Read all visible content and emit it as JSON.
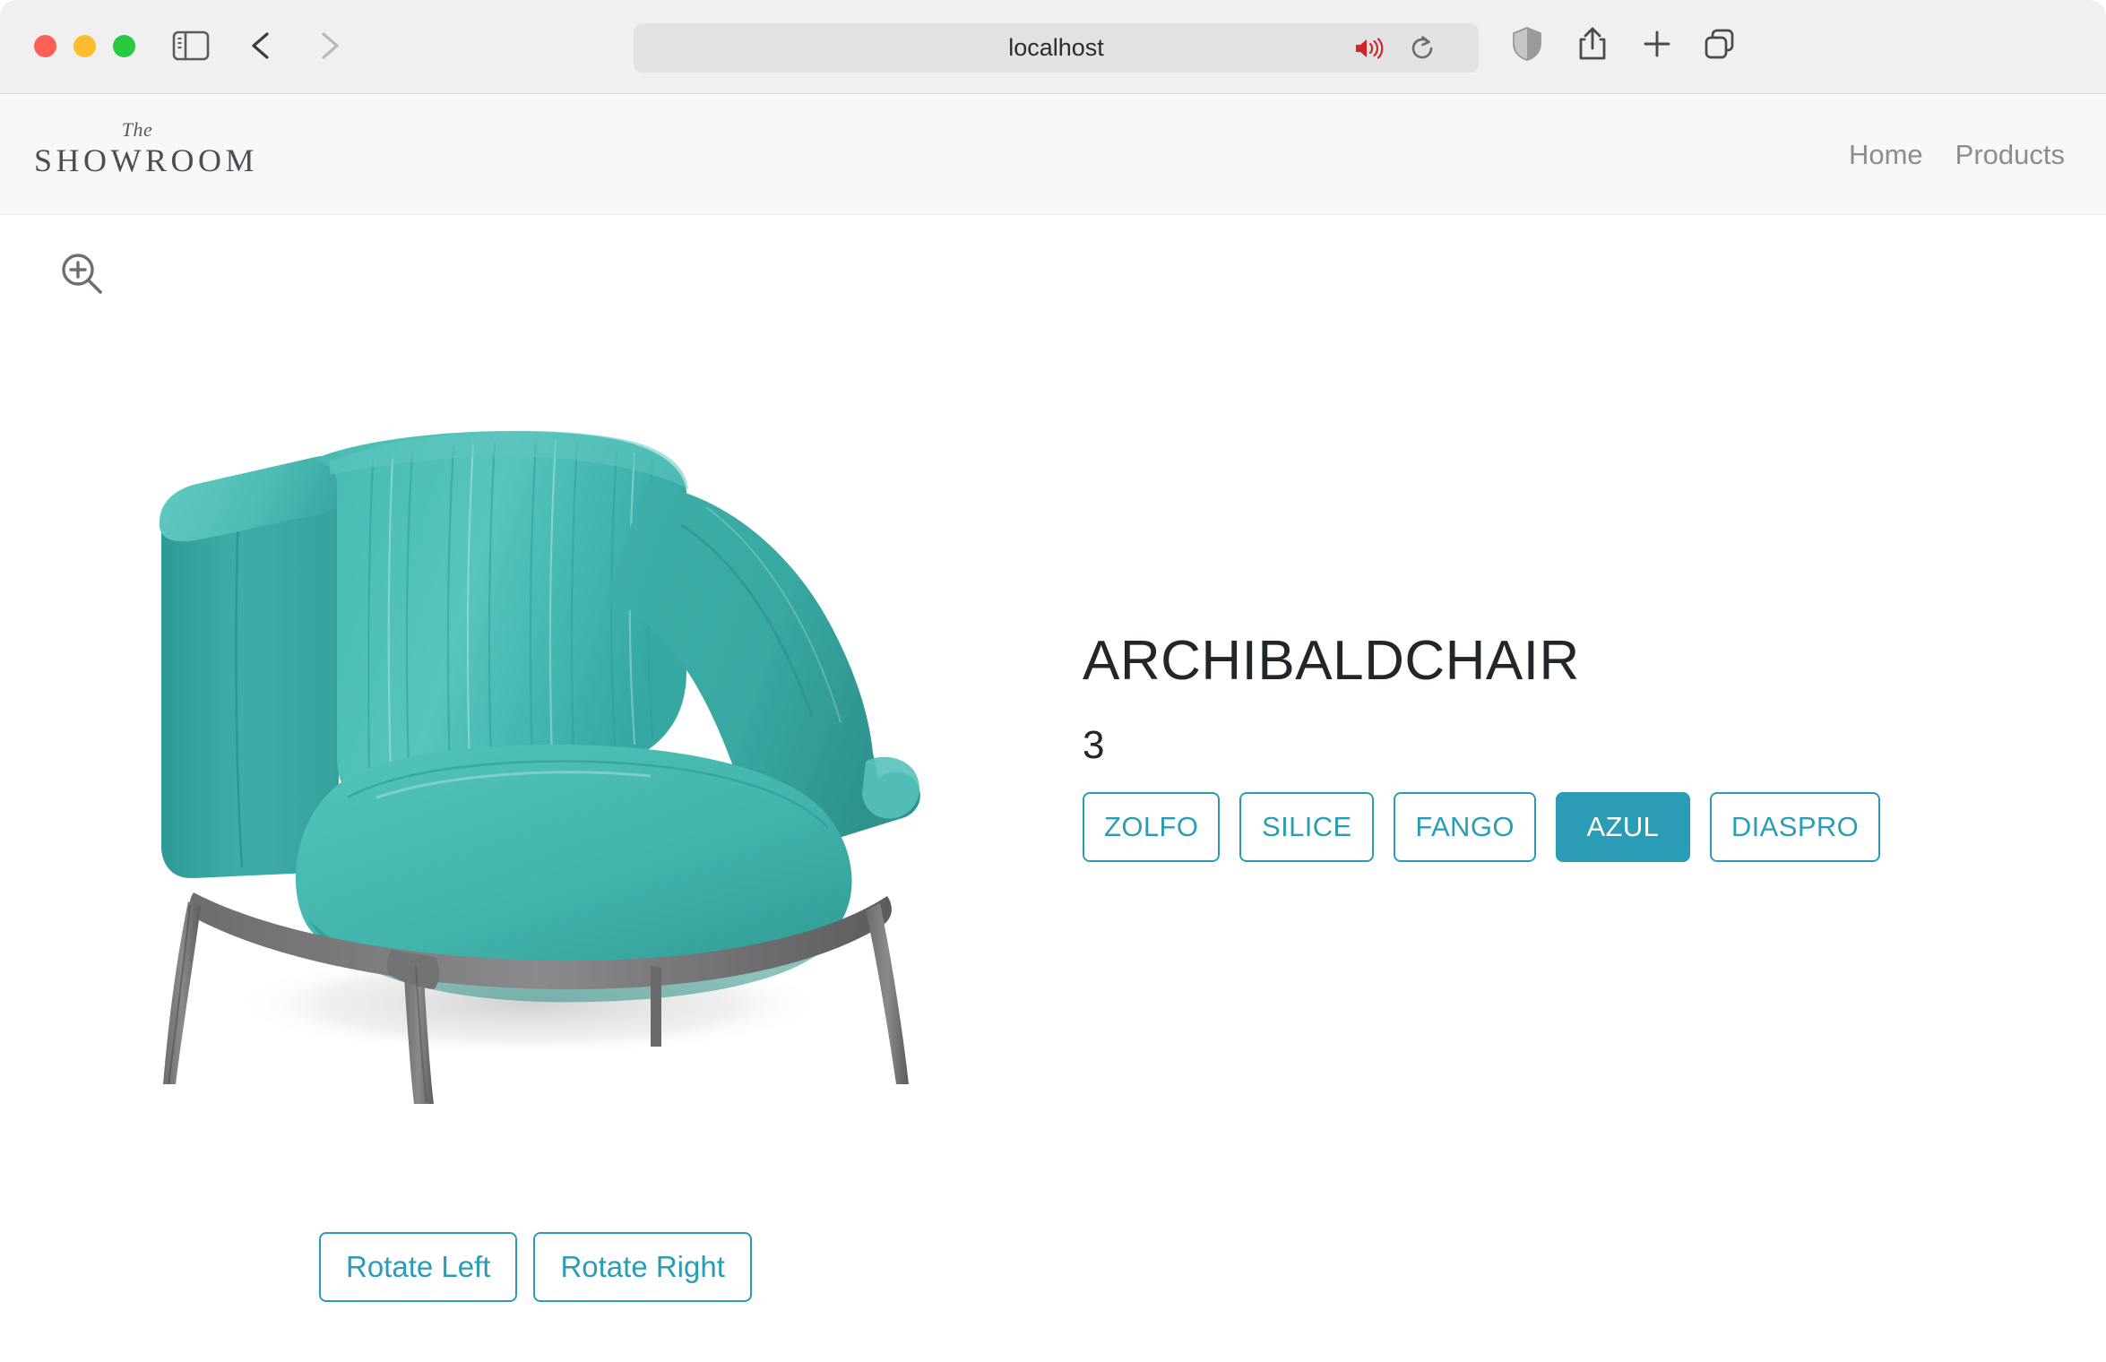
{
  "browser": {
    "url": "localhost",
    "traffic_lights": [
      {
        "name": "close-button",
        "color": "#ff5f57"
      },
      {
        "name": "minimize-button",
        "color": "#febc2e"
      },
      {
        "name": "maximize-button",
        "color": "#28c840"
      }
    ],
    "icons": {
      "sidebar": "sidebar-toggle-icon",
      "back": "back-arrow-icon",
      "forward": "forward-arrow-icon",
      "audio": "speaker-playing-icon",
      "reload": "reload-icon",
      "shield": "privacy-shield-icon",
      "share": "share-icon",
      "newtab": "plus-icon",
      "tabs": "tab-overview-icon"
    },
    "audio_icon_color": "#d0252a"
  },
  "site": {
    "brand": {
      "prefix": "The",
      "name": "SHOWROOM"
    },
    "nav": [
      {
        "label": "Home"
      },
      {
        "label": "Products"
      }
    ]
  },
  "viewer": {
    "zoom_icon": "zoom-in-magnifier-icon",
    "product_image_alt": "ARCHIBALDCHAIR armchair in AZUL turquoise leather with grey metal legs",
    "chair_colors": {
      "body_light": "#5dc3bc",
      "body_mid": "#3aada8",
      "body_dark": "#2f9a95",
      "body_shadow": "#28857f",
      "legs": "#7a7a7c",
      "legs_dark": "#5d5d60",
      "floor_shadow": "#d8d8d8"
    },
    "rotate_controls": [
      {
        "label": "Rotate Left"
      },
      {
        "label": "Rotate Right"
      }
    ]
  },
  "product": {
    "title": "ARCHIBALDCHAIR",
    "quantity": "3",
    "accent_color": "#2a9cb5",
    "color_options": [
      {
        "label": "ZOLFO",
        "selected": false
      },
      {
        "label": "SILICE",
        "selected": false
      },
      {
        "label": "FANGO",
        "selected": false
      },
      {
        "label": "AZUL",
        "selected": true
      },
      {
        "label": "DIASPRO",
        "selected": false
      }
    ]
  }
}
